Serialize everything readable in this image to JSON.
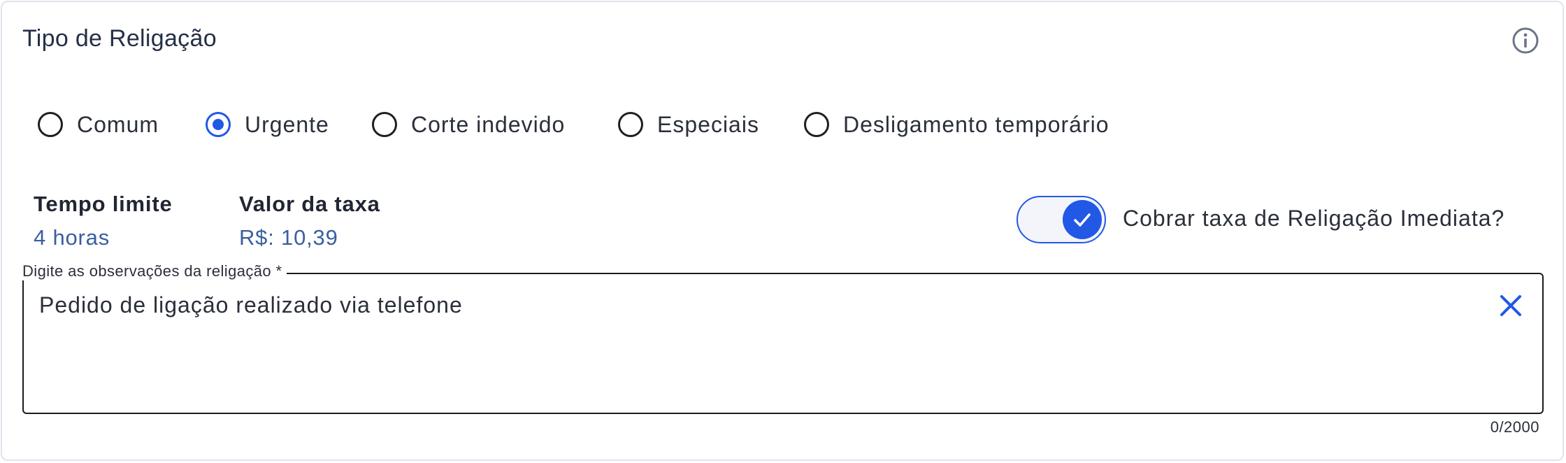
{
  "section": {
    "title": "Tipo de Religação",
    "info_icon": "info-circle-icon"
  },
  "reconnection_types": {
    "options": [
      {
        "label": "Comum",
        "selected": false
      },
      {
        "label": "Urgente",
        "selected": true
      },
      {
        "label": "Corte indevido",
        "selected": false
      },
      {
        "label": "Especiais",
        "selected": false
      },
      {
        "label": "Desligamento temporário",
        "selected": false
      }
    ]
  },
  "details": {
    "time_limit_label": "Tempo limite",
    "time_limit_value": "4 horas",
    "fee_label": "Valor da taxa",
    "fee_value": "R$: 10,39"
  },
  "immediate_fee": {
    "label": "Cobrar taxa de Religação Imediata?",
    "enabled": true
  },
  "observations": {
    "legend": "Digite as observações da religação *",
    "value": "Pedido de ligação realizado via telefone",
    "counter": "0/2000",
    "clear_icon": "close-icon"
  },
  "colors": {
    "accent": "#2258e6",
    "value_text": "#3a5fa0",
    "border": "#dfe3ee"
  }
}
